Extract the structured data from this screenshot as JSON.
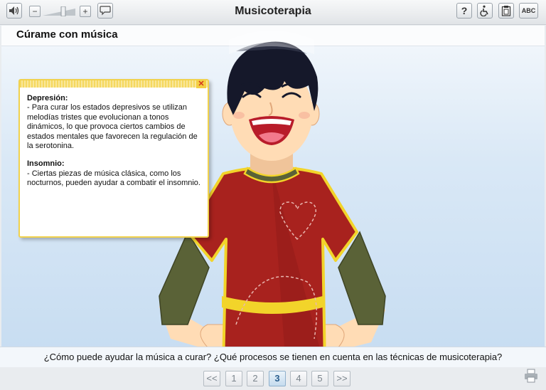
{
  "app": {
    "title": "Musicoterapia"
  },
  "toolbar": {
    "speaker_icon": "speaker-icon",
    "minus_label": "−",
    "plus_label": "+",
    "bubble_icon": "speech-bubble-icon",
    "help_label": "?",
    "accessibility_icon": "wheelchair-icon",
    "clipboard_icon": "clipboard-icon",
    "abc_label": "ABC"
  },
  "section": {
    "title": "Cúrame con música"
  },
  "note": {
    "paragraphs": [
      {
        "heading": "Depresión:",
        "text": "- Para curar los estados depresivos se utilizan melodías tristes que evolucionan a tonos dinámicos, lo que provoca ciertos cambios de estados mentales que favorecen la regulación de la serotonina."
      },
      {
        "heading": "Insomnio:",
        "text": "- Ciertas piezas de música clásica, como los nocturnos, pueden ayudar a combatir el insomnio."
      }
    ],
    "close_label": "✕"
  },
  "question": "¿Cómo puede ayudar la música a curar? ¿Qué procesos se tienen en cuenta en las técnicas de musicoterapia?",
  "pager": {
    "prev": "<<",
    "pages": [
      "1",
      "2",
      "3",
      "4",
      "5"
    ],
    "next": ">>",
    "current": "3"
  },
  "colors": {
    "shirt": "#a8221e",
    "trim": "#f2d42a",
    "sleeve": "#5a6237",
    "hair": "#15182a",
    "skin": "#ffdcb5"
  }
}
